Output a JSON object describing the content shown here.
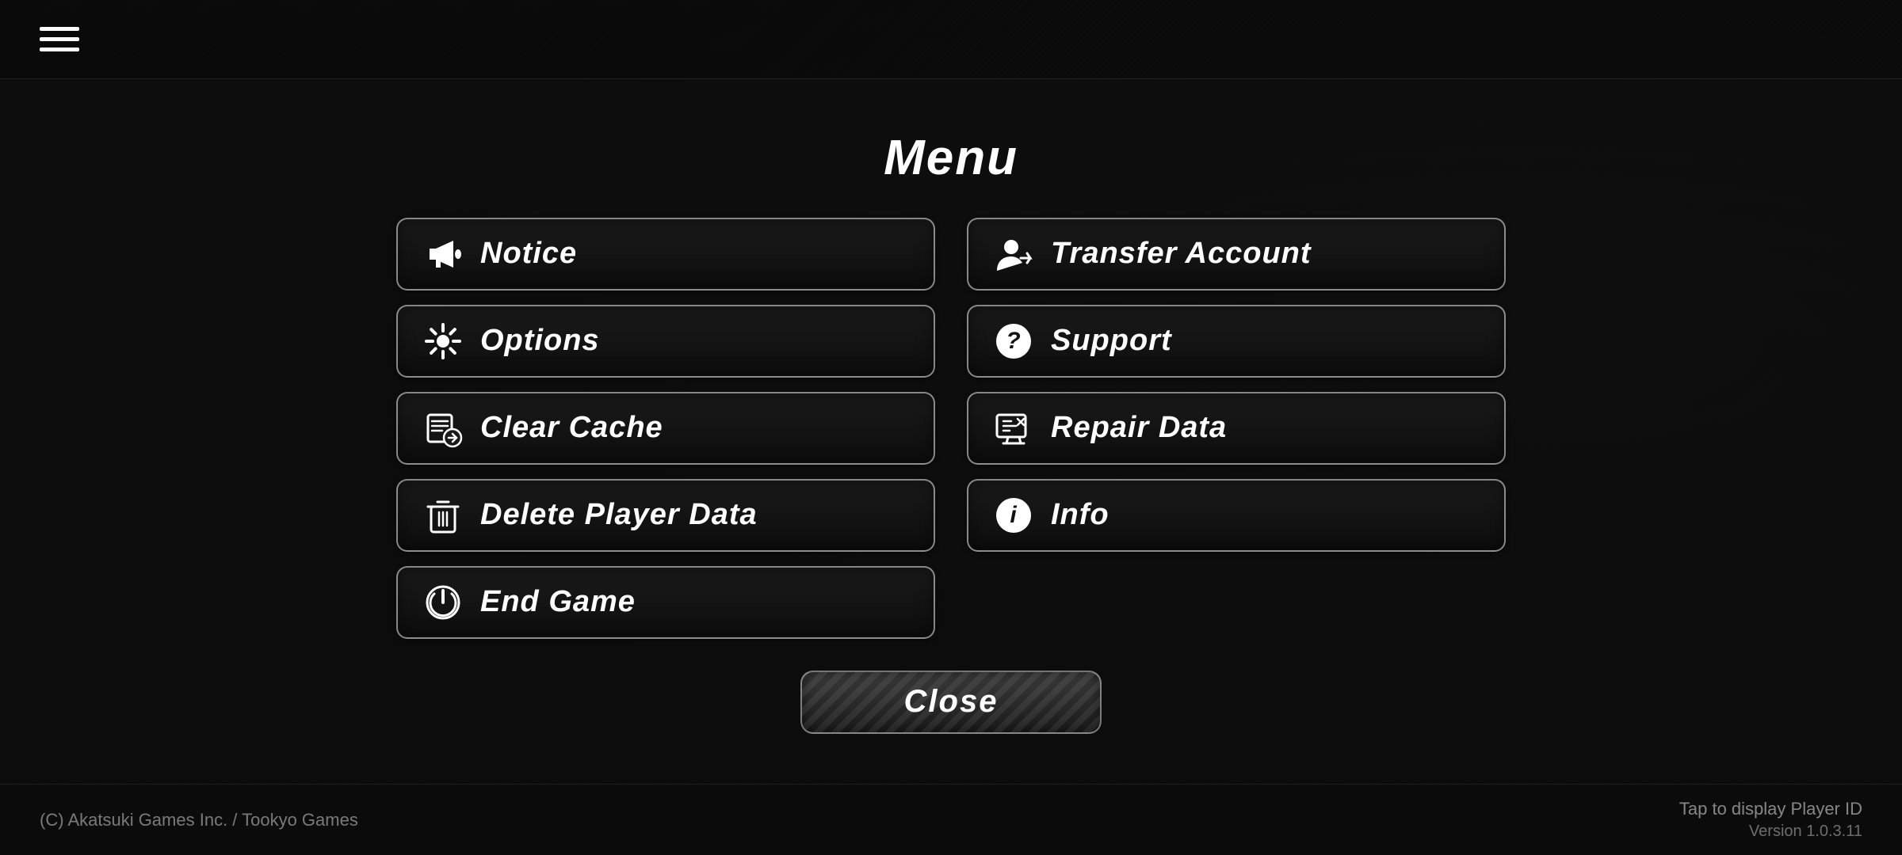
{
  "topbar": {
    "hamburger_label": "menu"
  },
  "menu": {
    "title": "Menu",
    "buttons_left": [
      {
        "id": "notice",
        "label": "Notice",
        "icon": "megaphone"
      },
      {
        "id": "options",
        "label": "Options",
        "icon": "gear"
      },
      {
        "id": "clear-cache",
        "label": "Clear Cache",
        "icon": "clearcache"
      },
      {
        "id": "delete-player-data",
        "label": "Delete Player Data",
        "icon": "trash"
      },
      {
        "id": "end-game",
        "label": "End Game",
        "icon": "power"
      }
    ],
    "buttons_right": [
      {
        "id": "transfer-account",
        "label": "Transfer Account",
        "icon": "transfer"
      },
      {
        "id": "support",
        "label": "Support",
        "icon": "question"
      },
      {
        "id": "repair-data",
        "label": "Repair Data",
        "icon": "repairdata"
      },
      {
        "id": "info",
        "label": "Info",
        "icon": "info"
      }
    ],
    "close_label": "Close"
  },
  "bottom": {
    "copyright": "(C) Akatsuki Games Inc. / Tookyo Games",
    "tap_display": "Tap to display Player ID",
    "version": "Version 1.0.3.11"
  }
}
